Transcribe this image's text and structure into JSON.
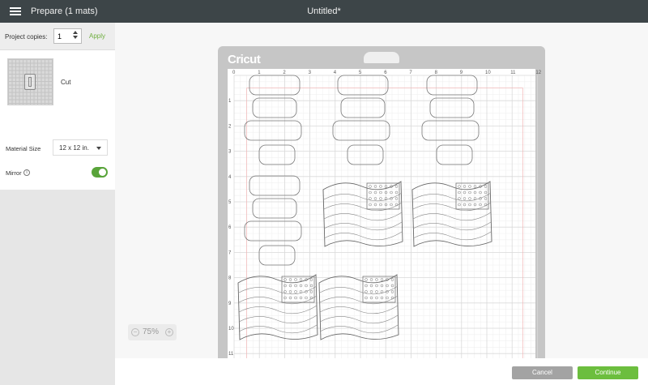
{
  "topbar": {
    "prepare_label": "Prepare (1 mats)",
    "title": "Untitled*"
  },
  "left_panel": {
    "copies_label": "Project copies:",
    "copies_value": "1",
    "apply_label": "Apply",
    "mat_label": "Cut",
    "material_size_label": "Material Size",
    "material_size_value": "12 x 12 in.",
    "mirror_label": "Mirror",
    "mirror_on": true
  },
  "mat": {
    "brand": "Cricut",
    "ruler_numbers": [
      "0",
      "1",
      "2",
      "3",
      "4",
      "5",
      "6",
      "7",
      "8",
      "9",
      "10",
      "11",
      "12"
    ]
  },
  "zoom": {
    "level": "75%",
    "zoom_out_icon": "minus-icon",
    "zoom_in_icon": "plus-icon"
  },
  "actions": {
    "cancel_label": "Cancel",
    "continue_label": "Continue"
  },
  "colors": {
    "accent_green": "#6cbe3e",
    "topbar": "#3d4548"
  }
}
